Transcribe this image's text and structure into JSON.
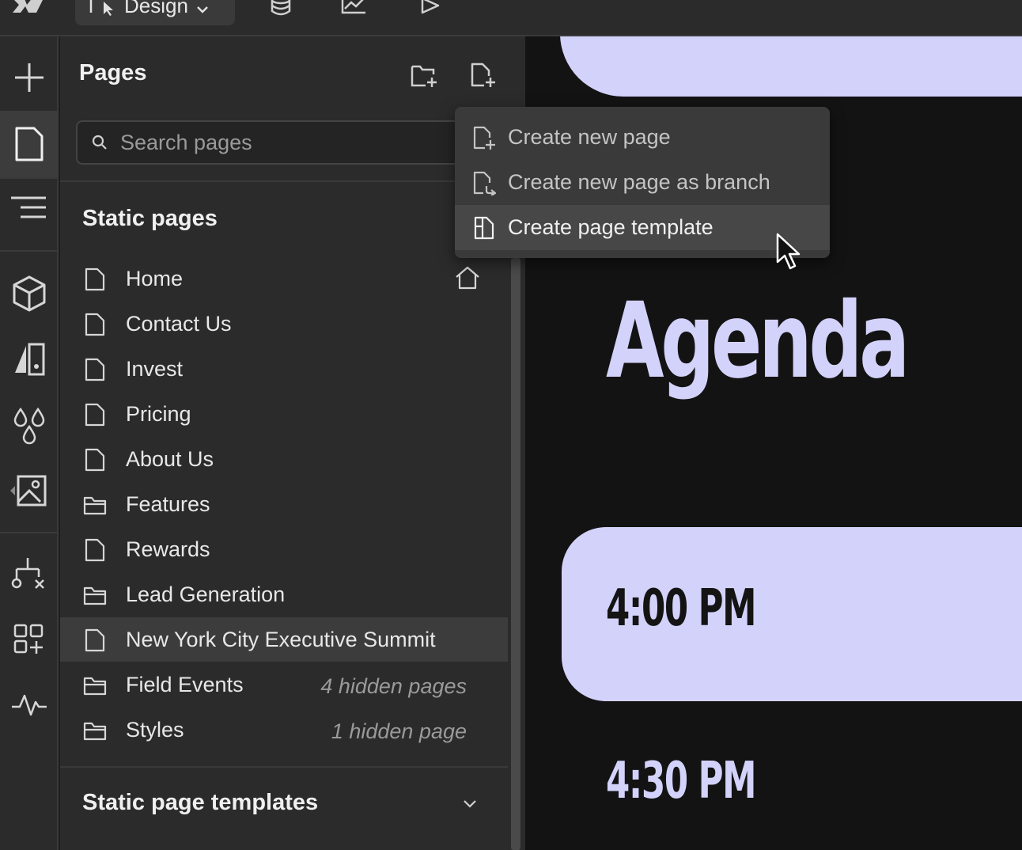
{
  "topbar": {
    "mode_label": "Design"
  },
  "panel": {
    "title": "Pages"
  },
  "search": {
    "placeholder": "Search pages"
  },
  "sections": {
    "static_pages": "Static pages",
    "static_page_templates": "Static page templates"
  },
  "pages": [
    {
      "name": "Home",
      "type": "page",
      "is_home": true
    },
    {
      "name": "Contact Us",
      "type": "page"
    },
    {
      "name": "Invest",
      "type": "page"
    },
    {
      "name": "Pricing",
      "type": "page"
    },
    {
      "name": "About Us",
      "type": "page"
    },
    {
      "name": "Features",
      "type": "folder"
    },
    {
      "name": "Rewards",
      "type": "page"
    },
    {
      "name": "Lead Generation",
      "type": "folder"
    },
    {
      "name": "New York City Executive Summit",
      "type": "page",
      "selected": true
    },
    {
      "name": "Field Events",
      "type": "folder",
      "note": "4 hidden pages"
    },
    {
      "name": "Styles",
      "type": "folder",
      "note": "1 hidden page"
    }
  ],
  "menu": {
    "items": [
      {
        "label": "Create new page",
        "icon": "file-plus-icon"
      },
      {
        "label": "Create new page as branch",
        "icon": "file-branch-icon"
      },
      {
        "label": "Create page template",
        "icon": "template-icon",
        "hover": true
      }
    ]
  },
  "canvas": {
    "heading": "Agenda",
    "time_1": "4:00 PM",
    "time_2": "4:30 PM"
  },
  "colors": {
    "accent": "#d3d2fb",
    "panel_bg": "#2b2b2b",
    "canvas_bg": "#131313"
  }
}
